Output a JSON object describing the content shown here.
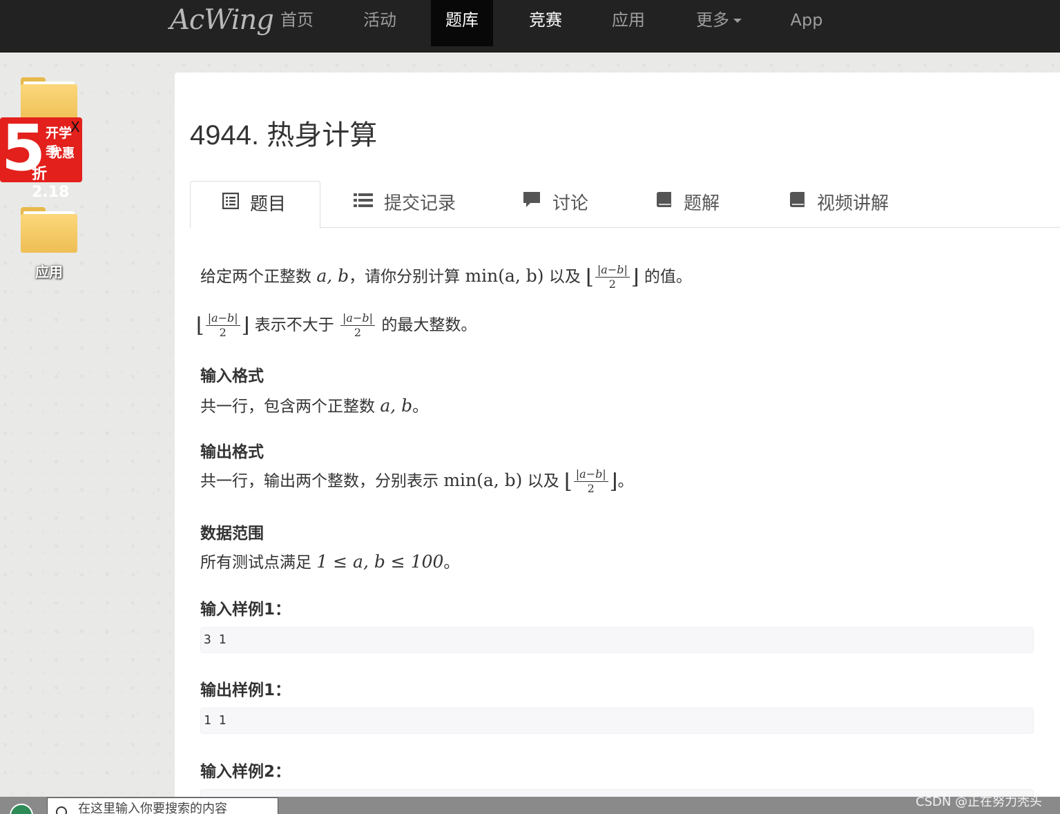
{
  "nav": {
    "brand": "AcWing",
    "items": [
      "首页",
      "活动",
      "题库",
      "竞赛",
      "应用",
      "更多",
      "App"
    ],
    "active": "题库"
  },
  "desktop": {
    "folder_label": "应用",
    "promo": {
      "big": "5",
      "line1": "开学季",
      "line2": "优惠",
      "line3": "折2.18",
      "close": "X"
    }
  },
  "problem": {
    "title": "4944. 热身计算",
    "tabs": [
      {
        "label": "题目",
        "icon": "list-alt-icon"
      },
      {
        "label": "提交记录",
        "icon": "list-icon"
      },
      {
        "label": "讨论",
        "icon": "comment-icon"
      },
      {
        "label": "题解",
        "icon": "book-icon"
      },
      {
        "label": "视频讲解",
        "icon": "book-icon"
      }
    ],
    "statement": {
      "p1_a": "给定两个正整数",
      "p1_vars": "a, b",
      "p1_b": "，请你分别计算",
      "p1_min": "min(a, b)",
      "p1_c": "以及",
      "frac_num": "|a−b|",
      "frac_den": "2",
      "p1_d": "的值。",
      "p2_a": "表示不大于",
      "p2_b": "的最大整数。"
    },
    "input_format": {
      "heading": "输入格式",
      "text_a": "共一行，包含两个正整数",
      "vars": "a, b",
      "text_b": "。"
    },
    "output_format": {
      "heading": "输出格式",
      "text_a": "共一行，输出两个整数，分别表示",
      "min": "min(a, b)",
      "text_b": "以及",
      "text_c": "。"
    },
    "range": {
      "heading": "数据范围",
      "text_a": "所有测试点满足",
      "expr": "1 ≤ a, b ≤ 100",
      "text_b": "。"
    },
    "samples": [
      {
        "heading": "输入样例1：",
        "value": "3 1"
      },
      {
        "heading": "输出样例1：",
        "value": "1 1"
      },
      {
        "heading": "输入样例2：",
        "value": ""
      }
    ]
  },
  "taskbar": {
    "search_placeholder": "在这里输入你要搜索的内容"
  },
  "watermark": "CSDN @正在努力秃头",
  "colors": {
    "navbar": "#222222",
    "nav_active": "#080808",
    "promo_red": "#e3201c",
    "folder_yellow": "#f4c85f"
  }
}
